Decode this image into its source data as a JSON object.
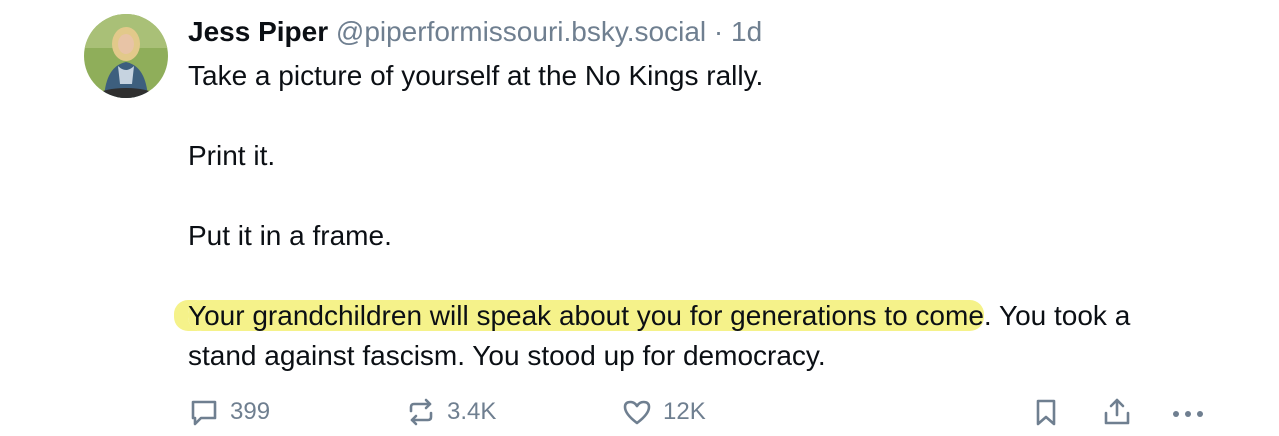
{
  "post": {
    "author_name": "Jess Piper",
    "handle": "@piperformissouri.bsky.social",
    "separator": "·",
    "time": "1d",
    "paragraphs": {
      "p1": "Take a picture of yourself at the No Kings rally.",
      "p2": "Print it.",
      "p3": "Put it in a frame.",
      "p4_highlight": "Your grandchildren will speak about you for generations to come",
      "p4_rest": ". You took a stand against fascism. You stood up for democracy."
    },
    "highlight_color": "#f5f28a"
  },
  "actions": {
    "reply": {
      "icon": "reply-icon",
      "count": "399"
    },
    "repost": {
      "icon": "repost-icon",
      "count": "3.4K"
    },
    "like": {
      "icon": "heart-icon",
      "count": "12K"
    },
    "bookmark": {
      "icon": "bookmark-icon"
    },
    "share": {
      "icon": "share-icon"
    },
    "more": {
      "icon": "more-icon"
    }
  },
  "colors": {
    "text": "#0b0f14",
    "muted": "#6f7f90"
  }
}
